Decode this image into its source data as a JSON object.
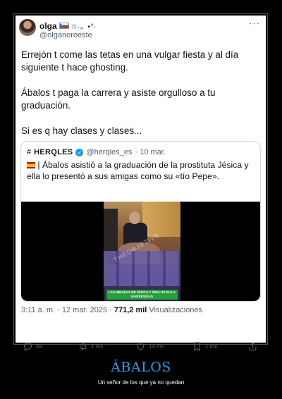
{
  "tweet": {
    "display_name": "olga",
    "name_deco": "☆·。•°·",
    "handle": "@olganoroeste",
    "more": "···",
    "paragraphs": [
      "Errejón t come las tetas en una vulgar fiesta y al día siguiente t hace ghosting.",
      "Ábalos t paga la carrera y asiste orgulloso a tu graduación.",
      "Si es q hay clases y clases..."
    ],
    "timestamp": "3:11 a. m. · 12 mar. 2025 ·",
    "views": "771,2 mil",
    "views_label": "Visualizaciones"
  },
  "quote": {
    "logo": "HERQLES",
    "handle": "@herqles_es",
    "date": "· 10 mar.",
    "text": "| Ábalos asistió a la graduación de la prostituta Jésica y ella lo presentó a sus amigas como su «tío Pepe».",
    "video_caption": "LAS MIRADAS DE JÉSICA Y ÁBALOS EN LA UNIVERSIDAD",
    "video_watermark": "THEOBJETIVE"
  },
  "actions": {
    "replies": "49",
    "retweets": "1 mil",
    "likes": "14 mil",
    "bookmarks": "1 mil"
  },
  "post": {
    "title": "ÁBALOS",
    "subtitle": "Un señor de los que ya no quedan"
  },
  "colors": {
    "accent": "#1da1f2",
    "verified": "#1d9bf0",
    "muted": "#536471"
  }
}
